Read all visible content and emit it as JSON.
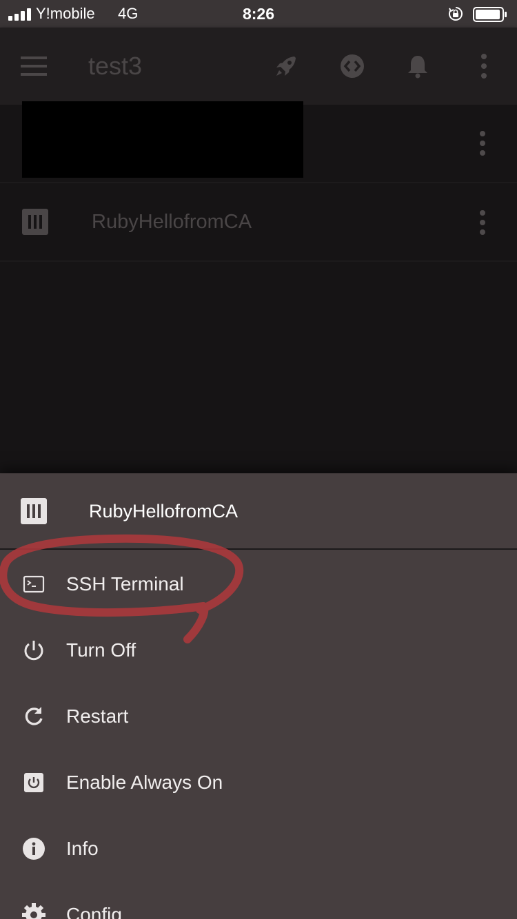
{
  "status_bar": {
    "carrier": "Y!mobile",
    "network": "4G",
    "time": "8:26"
  },
  "app_bar": {
    "title": "test3"
  },
  "list": {
    "rows": [
      {
        "label": "RubyHellofromCA"
      }
    ]
  },
  "sheet": {
    "title": "RubyHellofromCA",
    "items": [
      {
        "label": "SSH Terminal",
        "icon": "terminal-icon"
      },
      {
        "label": "Turn Off",
        "icon": "power-icon"
      },
      {
        "label": "Restart",
        "icon": "restart-icon"
      },
      {
        "label": "Enable Always On",
        "icon": "always-on-icon"
      },
      {
        "label": "Info",
        "icon": "info-icon"
      },
      {
        "label": "Config",
        "icon": "gear-icon"
      }
    ]
  },
  "colors": {
    "sheet_background": "#463e3f",
    "annotation": "#b0383c"
  }
}
